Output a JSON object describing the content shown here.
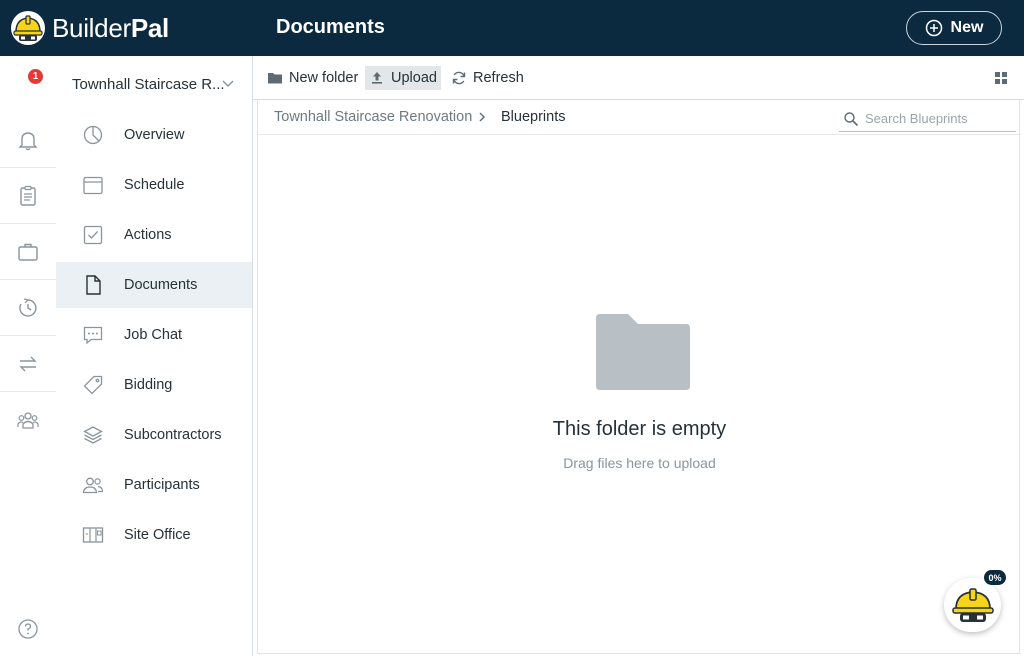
{
  "app": {
    "brand_part1": "Builder",
    "brand_part2": "Pal",
    "page_title": "Documents",
    "new_button_label": "New",
    "accent_color": "#0b2a3f",
    "hat_color": "#f7d417"
  },
  "project": {
    "name": "Townhall Staircase R..."
  },
  "rail": {
    "notification_count": "1",
    "icons": [
      "bell-icon",
      "clipboard-icon",
      "briefcase-icon",
      "history-icon",
      "transfer-icon",
      "team-icon"
    ]
  },
  "nav": {
    "items": [
      {
        "label": "Overview",
        "icon": "pie-chart-icon"
      },
      {
        "label": "Schedule",
        "icon": "calendar-icon"
      },
      {
        "label": "Actions",
        "icon": "checkbox-icon"
      },
      {
        "label": "Documents",
        "icon": "document-icon",
        "active": true
      },
      {
        "label": "Job Chat",
        "icon": "chat-icon"
      },
      {
        "label": "Bidding",
        "icon": "tag-icon"
      },
      {
        "label": "Subcontractors",
        "icon": "layers-icon"
      },
      {
        "label": "Participants",
        "icon": "people-icon"
      },
      {
        "label": "Site Office",
        "icon": "site-office-icon"
      }
    ]
  },
  "toolbar": {
    "new_folder_label": "New folder",
    "upload_label": "Upload",
    "refresh_label": "Refresh"
  },
  "breadcrumb": {
    "root": "Townhall Staircase Renovation",
    "current": "Blueprints"
  },
  "search": {
    "placeholder": "Search Blueprints"
  },
  "empty_state": {
    "title": "This folder is empty",
    "subtitle": "Drag files here to upload"
  },
  "assistant": {
    "progress_label": "0%"
  }
}
